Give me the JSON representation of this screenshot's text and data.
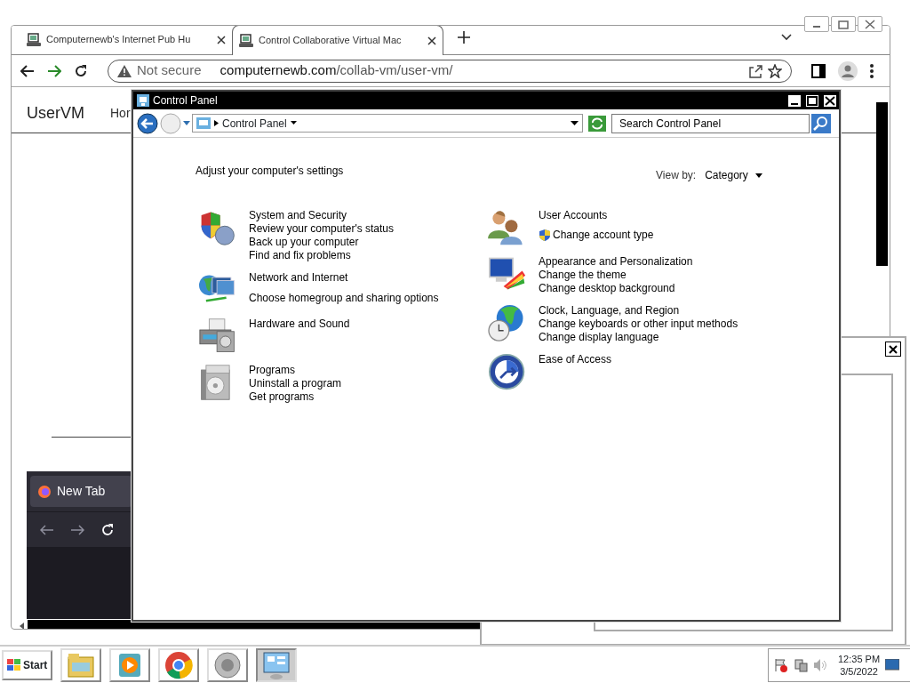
{
  "browser": {
    "tabs": [
      {
        "title": "Computernewb's Internet Pub Hu",
        "selected": false
      },
      {
        "title": "Control Collaborative Virtual Mac",
        "selected": true
      }
    ],
    "security": "Not secure",
    "url_host": "computernewb.com",
    "url_path": "/collab-vm/user-vm/"
  },
  "page": {
    "brand": "UserVM",
    "nav_item": "Hor",
    "inner_tab": "New Tab"
  },
  "control_panel": {
    "title": "Control Panel",
    "breadcrumb": "Control Panel",
    "search_placeholder": "Search Control Panel",
    "heading": "Adjust your computer's settings",
    "view_by_label": "View by:",
    "view_by_value": "Category",
    "left_categories": [
      {
        "kind": "shield",
        "title": "System and Security",
        "links": [
          {
            "text": "Review your computer's status",
            "uac": false
          },
          {
            "text": "Back up your computer",
            "uac": false
          },
          {
            "text": "Find and fix problems",
            "uac": false
          }
        ]
      },
      {
        "kind": "network",
        "title": "Network and Internet",
        "links": [
          {
            "text": "Choose homegroup and sharing options",
            "uac": false
          }
        ]
      },
      {
        "kind": "printer",
        "title": "Hardware and Sound"
      },
      {
        "kind": "programs",
        "title": "Programs",
        "links": [
          {
            "text": "Uninstall a program",
            "uac": false
          },
          {
            "text": "Get programs",
            "uac": false
          }
        ]
      }
    ],
    "right_categories": [
      {
        "kind": "users",
        "title": "User Accounts",
        "links": [
          {
            "text": "Change account type",
            "uac": true
          }
        ]
      },
      {
        "kind": "appearance",
        "title": "Appearance and Personalization",
        "links": [
          {
            "text": "Change the theme",
            "uac": false
          },
          {
            "text": "Change desktop background",
            "uac": false
          }
        ]
      },
      {
        "kind": "globe",
        "title": "Clock, Language, and Region",
        "links": [
          {
            "text": "Change keyboards or other input methods",
            "uac": false
          },
          {
            "text": "Change display language",
            "uac": false
          }
        ]
      },
      {
        "kind": "ease",
        "title": "Ease of Access"
      }
    ]
  },
  "taskbar": {
    "start": "Start",
    "buttons": [
      {
        "kind": "explorer",
        "selected": false
      },
      {
        "kind": "media",
        "selected": false
      },
      {
        "kind": "chrome",
        "selected": false
      },
      {
        "kind": "speaker",
        "selected": false
      },
      {
        "kind": "control-panel",
        "selected": true
      }
    ],
    "time": "12:35 PM",
    "date": "3/5/2022"
  }
}
